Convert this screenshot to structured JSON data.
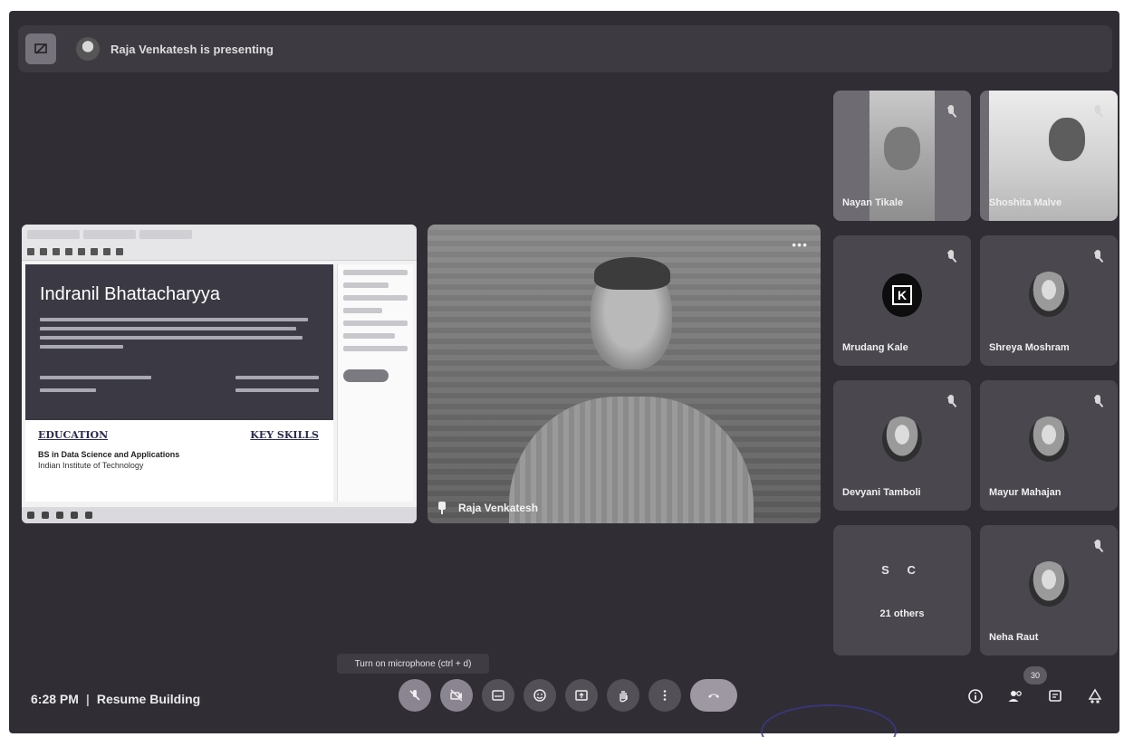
{
  "presenting": {
    "text": "Raja Venkatesh is presenting"
  },
  "shared_screen": {
    "doc_name": "Indranil Bhattacharyya",
    "section_education": "EDUCATION",
    "section_skills": "KEY SKILLS",
    "degree": "BS in Data Science and Applications",
    "institute": "Indian Institute of Technology"
  },
  "main_tile": {
    "name": "Raja Venkatesh"
  },
  "participants": [
    {
      "name": "Nayan Tikale"
    },
    {
      "name": "Shoshita Malve"
    },
    {
      "name": "Mrudang Kale"
    },
    {
      "name": "Shreya Moshram"
    },
    {
      "name": "Devyani Tamboli"
    },
    {
      "name": "Mayur Mahajan"
    },
    {
      "name": "Neha Raut"
    }
  ],
  "others": {
    "initials": "S C",
    "label": "21 others"
  },
  "tooltip": {
    "text": "Turn on microphone (ctrl + d)"
  },
  "meeting": {
    "time": "6:28 PM",
    "separator": "|",
    "title": "Resume Building"
  },
  "people_count": "30",
  "icons": {
    "mic": "mic-off-icon",
    "camera": "camera-off-icon",
    "captions": "captions-icon",
    "emoji": "emoji-icon",
    "present": "present-screen-icon",
    "hand": "raise-hand-icon",
    "more": "more-options-icon",
    "end": "end-call-icon",
    "info": "info-icon",
    "people": "people-icon",
    "chat": "chat-icon",
    "activities": "activities-icon"
  }
}
